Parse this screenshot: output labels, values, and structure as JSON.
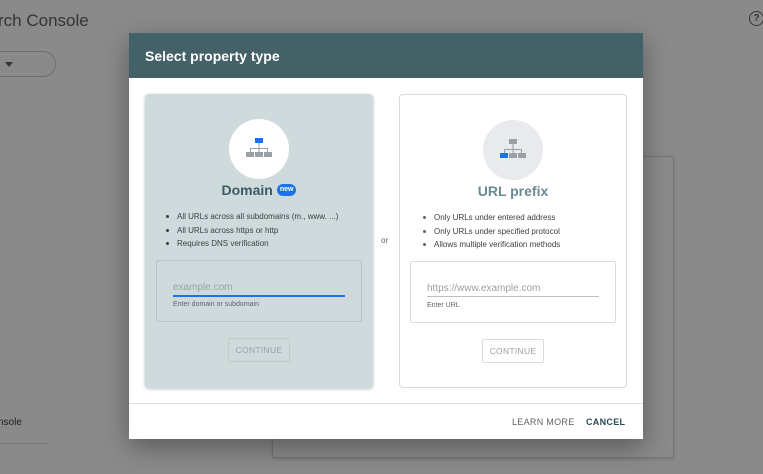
{
  "app": {
    "title": "rch Console",
    "help_icon": "?",
    "console_label": "nsole"
  },
  "dialog": {
    "title": "Select property type",
    "or_label": "or",
    "domain": {
      "icon": "sitemap-icon",
      "heading": "Domain",
      "badge": "new",
      "bullets": [
        "All URLs across all subdomains (m., www. ...)",
        "All URLs across https or http",
        "Requires DNS verification"
      ],
      "input_placeholder": "example.com",
      "input_value": "",
      "input_helper": "Enter domain or subdomain",
      "continue_label": "CONTINUE"
    },
    "url_prefix": {
      "icon": "sitemap-icon",
      "heading": "URL prefix",
      "bullets": [
        "Only URLs under entered address",
        "Only URLs under specified protocol",
        "Allows multiple verification methods"
      ],
      "input_placeholder": "https://www.example.com",
      "input_value": "",
      "input_helper": "Enter URL",
      "continue_label": "CONTINUE"
    },
    "footer": {
      "learn_more_label": "LEARN MORE",
      "cancel_label": "CANCEL"
    }
  },
  "colors": {
    "header": "#456168",
    "accent": "#1a73e8",
    "domain_panel": "#cfdadd"
  }
}
